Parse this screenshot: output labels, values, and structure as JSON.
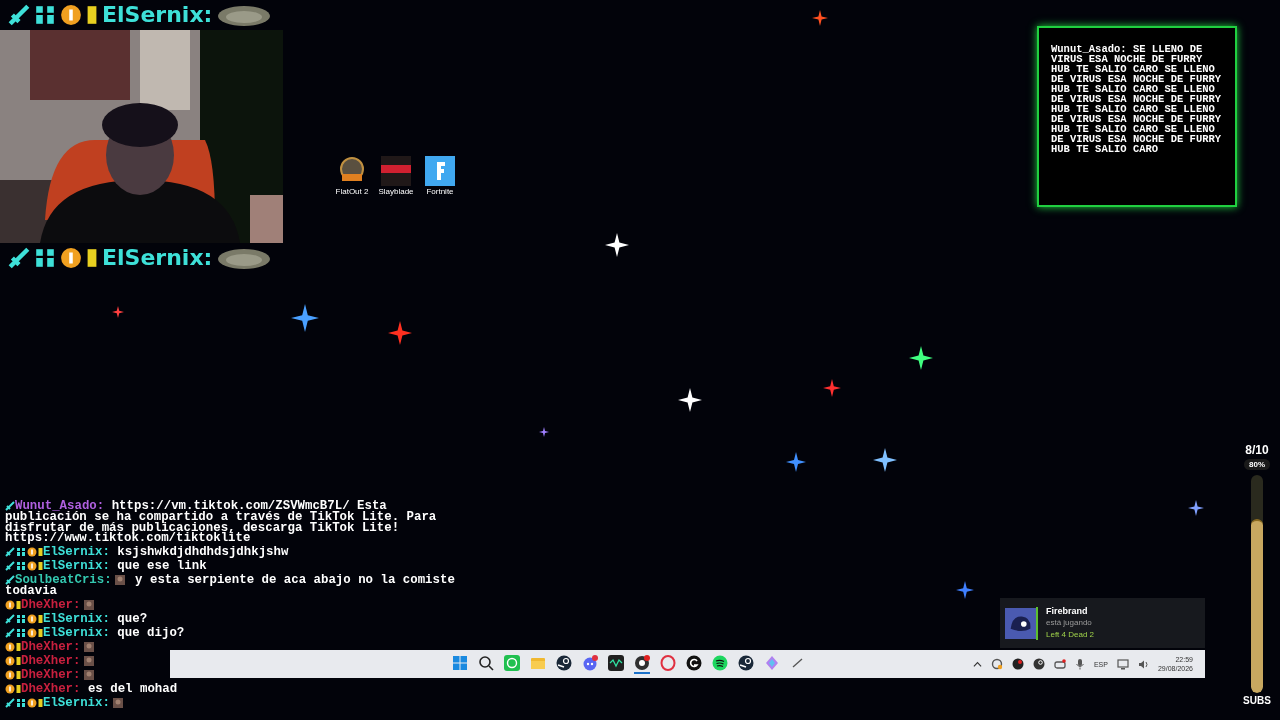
{
  "cam_header": {
    "badges": [
      {
        "kind": "sword"
      },
      {
        "kind": "ag"
      },
      {
        "kind": "sub"
      },
      {
        "kind": "bits"
      }
    ],
    "name": "ElSernix:"
  },
  "cam_footer": {
    "badges": [
      {
        "kind": "sword"
      },
      {
        "kind": "ag"
      },
      {
        "kind": "sub"
      },
      {
        "kind": "bits"
      }
    ],
    "name": "ElSernix:"
  },
  "desktop_icons": [
    {
      "label": "FlatOut 2",
      "kind": "flatout"
    },
    {
      "label": "Slayblade",
      "kind": "slayblade"
    },
    {
      "label": "Fortnite",
      "kind": "fortnite"
    }
  ],
  "alert": {
    "user": "Wunut_Asado:",
    "text": "SE LLENO DE VIRUS ESA NOCHE DE FURRY HUB TE SALIO CARO SE LLENO DE VIRUS ESA NOCHE DE FURRY HUB TE SALIO CARO SE LLENO DE VIRUS ESA NOCHE DE FURRY HUB TE SALIO CARO SE LLENO DE VIRUS ESA NOCHE DE FURRY HUB TE SALIO CARO SE LLENO DE VIRUS ESA NOCHE DE FURRY HUB TE SALIO CARO"
  },
  "chat": [
    {
      "user": "Wunut_Asado:",
      "color": "#b060e0",
      "badges": [
        {
          "kind": "sword"
        }
      ],
      "emote": false,
      "text": "https://vm.tiktok.com/ZSVWmcB7L/ Esta publicación se ha compartido a través de TikTok Lite. Para disfrutar de más publicaciones, descarga TikTok Lite! https://www.tiktok.com/tiktoklite"
    },
    {
      "user": "ElSernix:",
      "color": "#3ee0d8",
      "badges": [
        {
          "kind": "sword"
        },
        {
          "kind": "ag"
        },
        {
          "kind": "sub"
        },
        {
          "kind": "bits"
        }
      ],
      "emote": false,
      "text": "ksjshwkdjdhdhdsjdhkjshw"
    },
    {
      "user": "ElSernix:",
      "color": "#3ee0d8",
      "badges": [
        {
          "kind": "sword"
        },
        {
          "kind": "ag"
        },
        {
          "kind": "sub"
        },
        {
          "kind": "bits"
        }
      ],
      "emote": false,
      "text": "que ese link"
    },
    {
      "user": "SoulbeatCris:",
      "color": "#34c8b0",
      "badges": [
        {
          "kind": "sword"
        }
      ],
      "emote": true,
      "text": "y esta serpiente de aca abajo no la comiste todavia"
    },
    {
      "user": "DheXher:",
      "color": "#c8203e",
      "badges": [
        {
          "kind": "sub"
        },
        {
          "kind": "bits"
        }
      ],
      "emote": true
    },
    {
      "user": "ElSernix:",
      "color": "#3ee0d8",
      "badges": [
        {
          "kind": "sword"
        },
        {
          "kind": "ag"
        },
        {
          "kind": "sub"
        },
        {
          "kind": "bits"
        }
      ],
      "emote": false,
      "text": "que?"
    },
    {
      "user": "ElSernix:",
      "color": "#3ee0d8",
      "badges": [
        {
          "kind": "sword"
        },
        {
          "kind": "ag"
        },
        {
          "kind": "sub"
        },
        {
          "kind": "bits"
        }
      ],
      "emote": false,
      "text": "que dijo?"
    },
    {
      "user": "DheXher:",
      "color": "#c8203e",
      "badges": [
        {
          "kind": "sub"
        },
        {
          "kind": "bits"
        }
      ],
      "emote": true
    },
    {
      "user": "DheXher:",
      "color": "#c8203e",
      "badges": [
        {
          "kind": "sub"
        },
        {
          "kind": "bits"
        }
      ],
      "emote": true
    },
    {
      "user": "DheXher:",
      "color": "#c8203e",
      "badges": [
        {
          "kind": "sub"
        },
        {
          "kind": "bits"
        }
      ],
      "emote": true
    },
    {
      "user": "DheXher:",
      "color": "#c8203e",
      "badges": [
        {
          "kind": "sub"
        },
        {
          "kind": "bits"
        }
      ],
      "emote": false,
      "text": "es del mohad"
    },
    {
      "user": "ElSernix:",
      "color": "#3ee0d8",
      "badges": [
        {
          "kind": "sword"
        },
        {
          "kind": "ag"
        },
        {
          "kind": "sub"
        },
        {
          "kind": "bits"
        }
      ],
      "emote": true
    }
  ],
  "notification": {
    "title": "Firebrand",
    "status": "está jugando",
    "game": "Left 4 Dead 2"
  },
  "taskbar": {
    "apps": [
      {
        "kind": "start",
        "selected": false
      },
      {
        "kind": "search",
        "selected": false
      },
      {
        "kind": "whatsapp",
        "selected": false
      },
      {
        "kind": "folder",
        "selected": false
      },
      {
        "kind": "steam",
        "selected": false
      },
      {
        "kind": "discord",
        "selected": false
      },
      {
        "kind": "wave",
        "selected": false
      },
      {
        "kind": "obs",
        "selected": true
      },
      {
        "kind": "opera",
        "selected": false
      },
      {
        "kind": "g",
        "selected": false
      },
      {
        "kind": "spotify",
        "selected": false
      },
      {
        "kind": "steam",
        "selected": false
      },
      {
        "kind": "diamond",
        "selected": false
      },
      {
        "kind": "pen",
        "selected": false
      }
    ],
    "tray": {
      "language": "ESP",
      "time": "22:59",
      "date": "29/08/2026"
    }
  },
  "sub_goal": {
    "count": "8/10",
    "percent": "80%",
    "level": 0.8,
    "label": "SUBS"
  }
}
